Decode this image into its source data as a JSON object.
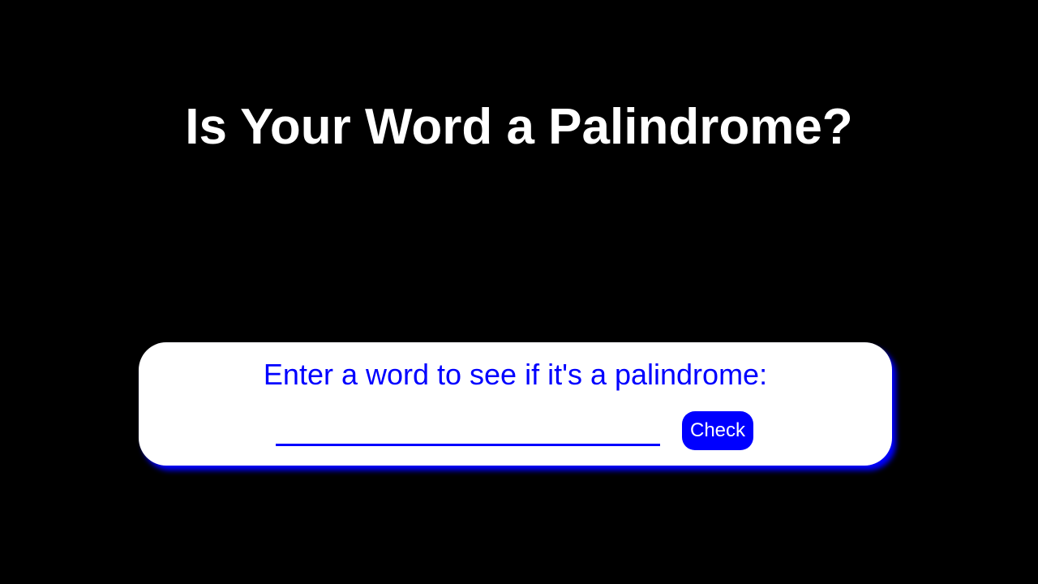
{
  "page": {
    "title": "Is Your Word a Palindrome?"
  },
  "card": {
    "prompt": "Enter a word to see if it's a palindrome:",
    "input": {
      "value": "",
      "placeholder": ""
    },
    "check_label": "Check"
  },
  "colors": {
    "background": "#000000",
    "title_text": "#ffffff",
    "card_background": "#ffffff",
    "accent": "#0000ff",
    "button_text": "#ffffff"
  }
}
